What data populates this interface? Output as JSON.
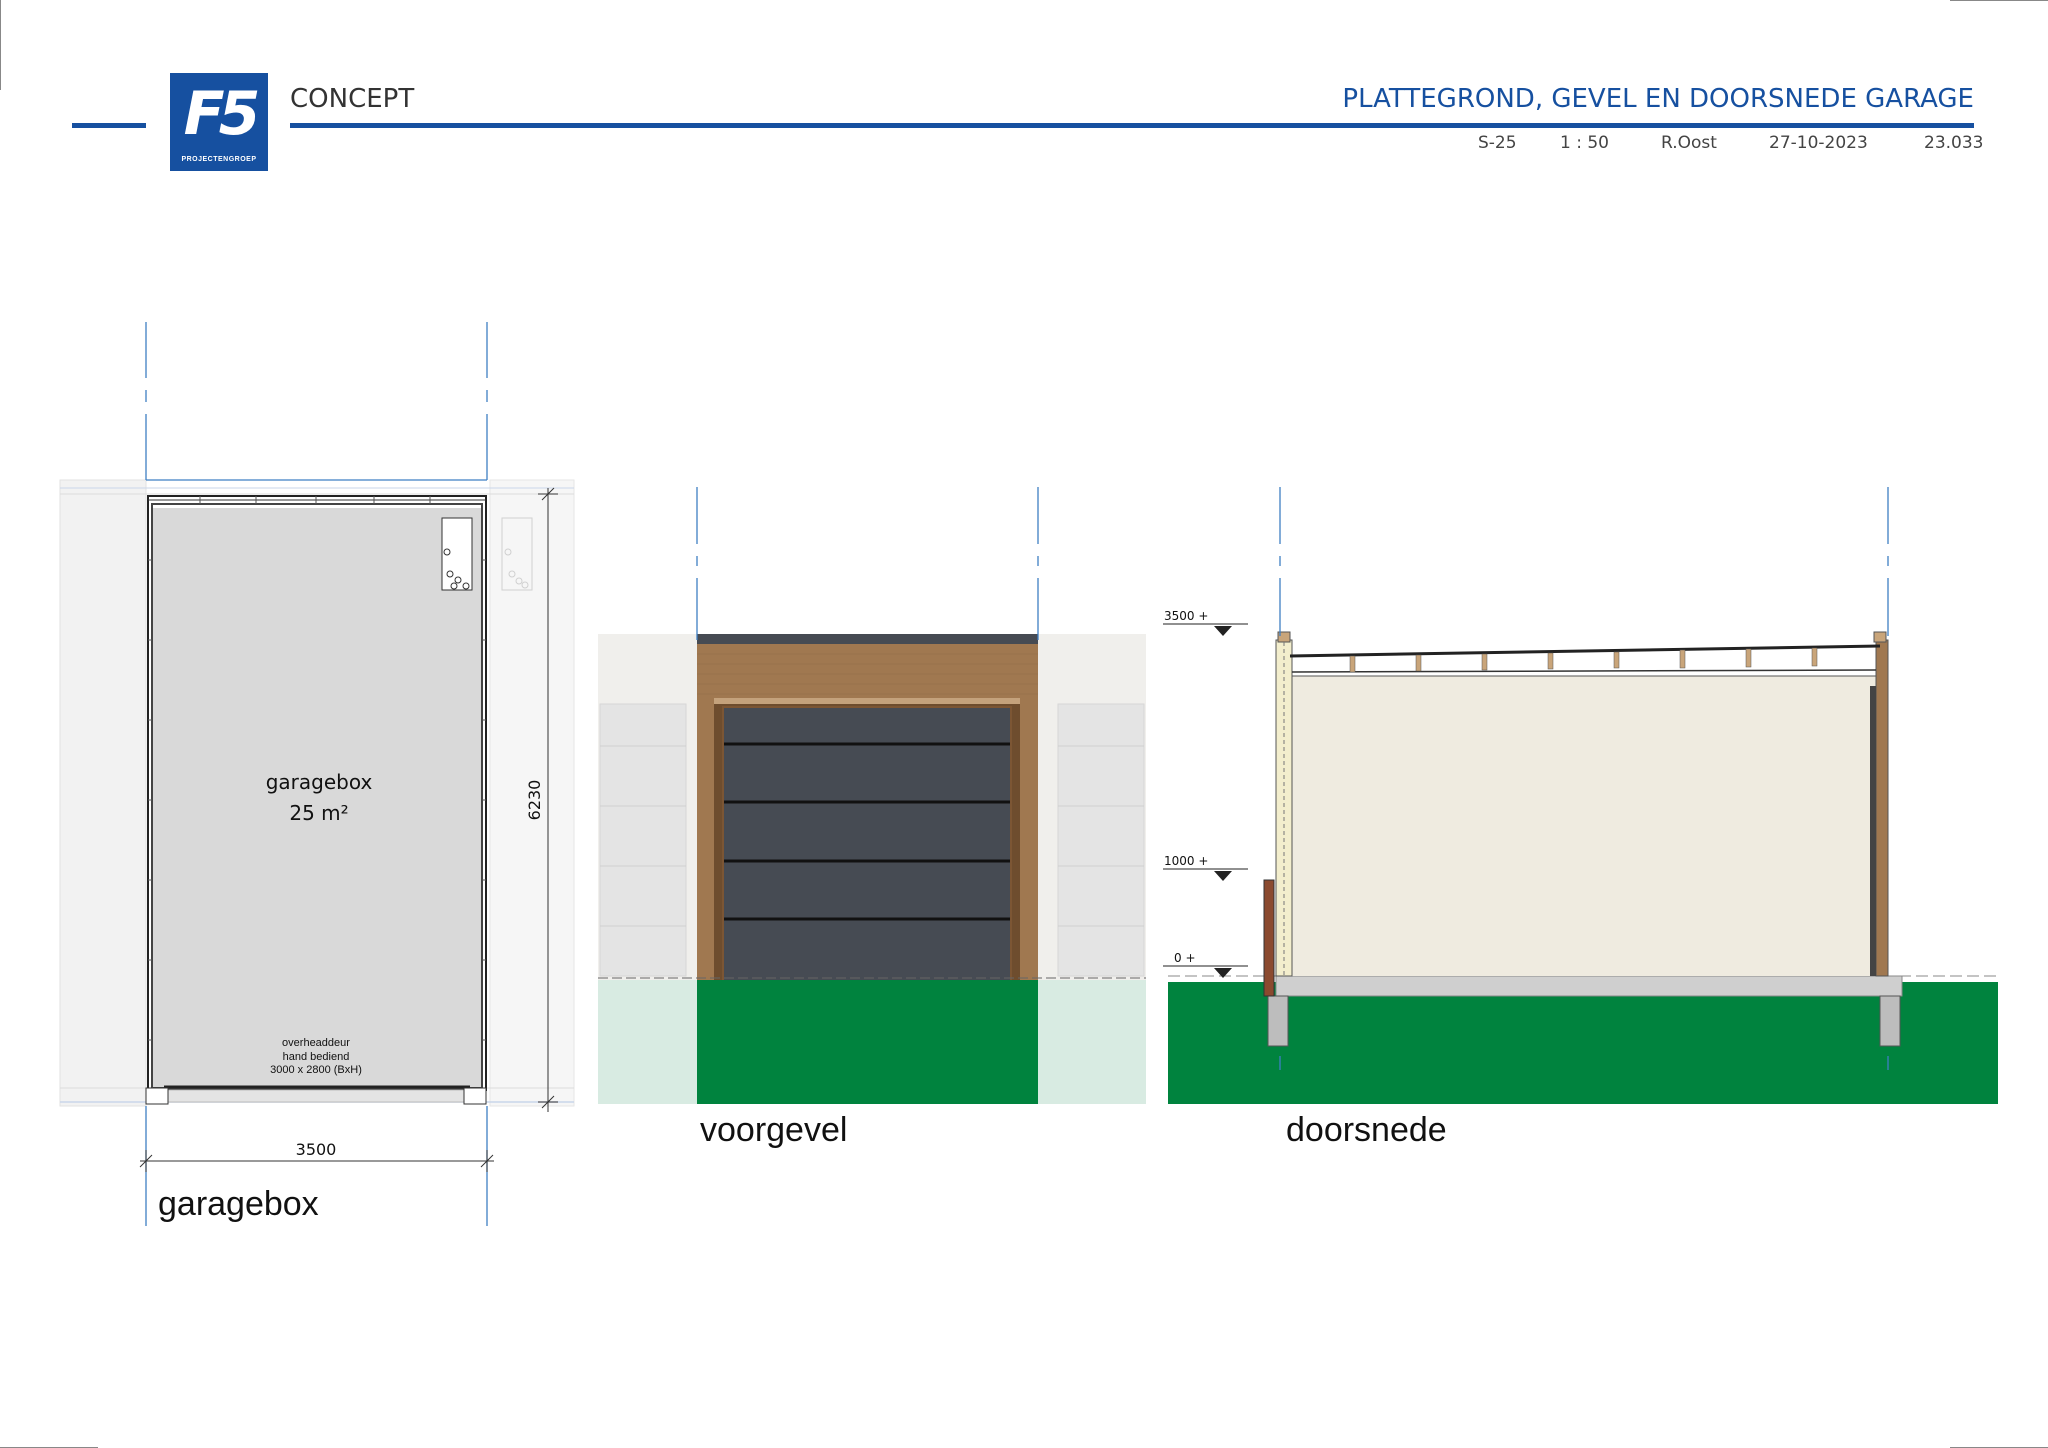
{
  "header": {
    "logo_text": "F5",
    "logo_subtext": "PROJECTENGROEP",
    "status": "CONCEPT",
    "title": "PLATTEGROND, GEVEL EN DOORSNEDE GARAGE",
    "sheet": "S-25",
    "scale": "1 : 50",
    "author": "R.Oost",
    "date": "27-10-2023",
    "project_number": "23.033"
  },
  "plan": {
    "caption": "garagebox",
    "room_name": "garagebox",
    "room_area": "25 m²",
    "door_label_1": "overheaddeur",
    "door_label_2": "hand bediend",
    "door_label_3": "3000 x  2800 (BxH)",
    "dim_width": "3500",
    "dim_depth": "6230"
  },
  "elevation": {
    "caption": "voorgevel"
  },
  "section": {
    "caption": "doorsnede",
    "level_top": "3500 +",
    "level_mid": "1000 +",
    "level_zero": "0 +"
  },
  "colors": {
    "brand": "#1650a0",
    "grass": "#00833e",
    "grass_faded": "#d8ebe2",
    "wood": "#a07850",
    "door": "#464b53",
    "wall_cream": "#efebe0",
    "floor_grey": "#d9d9d9"
  }
}
